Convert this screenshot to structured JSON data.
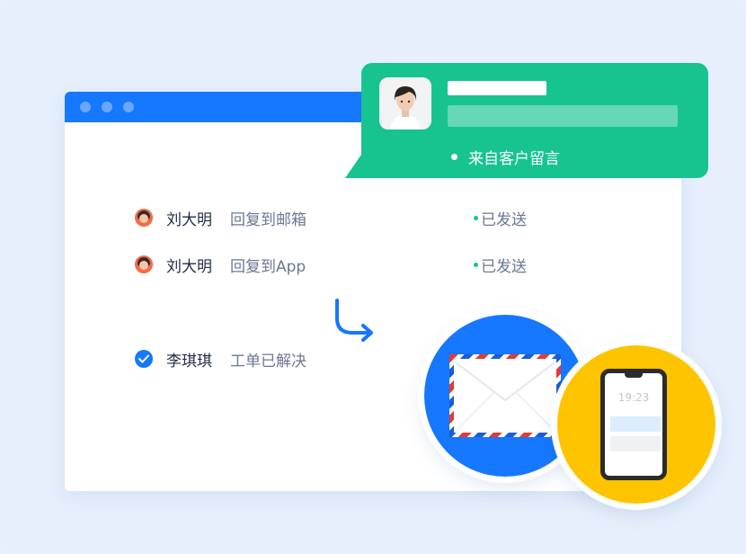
{
  "notification": {
    "source_label": "来自客户留言"
  },
  "rows": [
    {
      "name": "刘大明",
      "action": "回复到邮箱",
      "status": "已发送"
    },
    {
      "name": "刘大明",
      "action": "回复到App",
      "status": "已发送"
    }
  ],
  "resolved": {
    "name": "李琪琪",
    "action": "工单已解决"
  },
  "phone": {
    "time": "19:23"
  },
  "colors": {
    "primary_blue": "#1677ff",
    "accent_green": "#17c38f",
    "accent_yellow": "#ffc400",
    "background": "#e6effb"
  },
  "icons": [
    "avatar",
    "check-icon",
    "arrow-down-right-icon",
    "envelope-icon",
    "phone-icon"
  ]
}
